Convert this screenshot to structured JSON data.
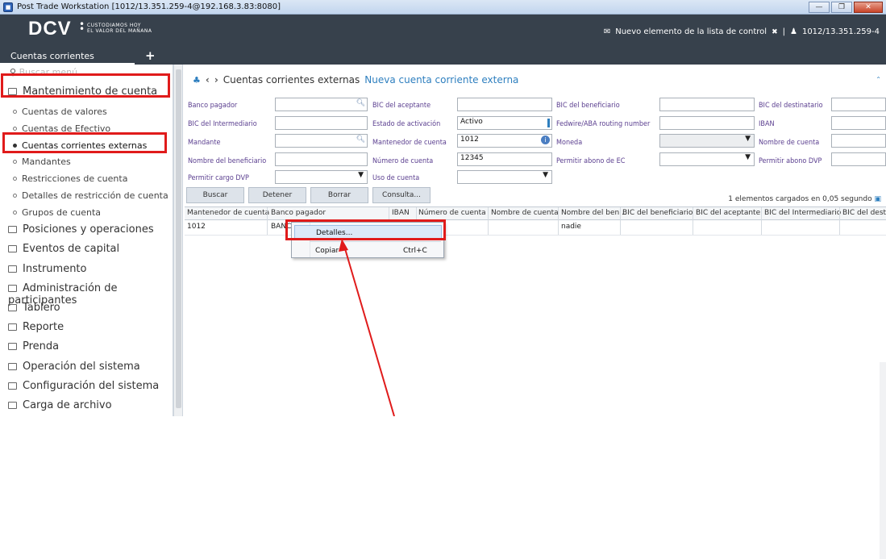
{
  "window": {
    "title": "Post Trade Workstation [1012/13.351.259-4@192.168.3.83:8080]",
    "controls": [
      "minimize-icon",
      "maximize-icon",
      "close-icon"
    ]
  },
  "header": {
    "logo": "DCV",
    "logo_tagline_1": "CUSTODIAMOS HOY",
    "logo_tagline_2": "EL VALOR DEL MAÑANA",
    "watchlist_label": "Nuevo elemento de la lista de control",
    "watchlist_close": "✖",
    "separator": "|",
    "user": "1012/13.351.259-4"
  },
  "tabs": {
    "active": "Cuentas corrientes externas",
    "add": "+"
  },
  "sidebar": {
    "search_placeholder": "Buscar menú",
    "section": "Mantenimiento de cuenta",
    "sub_items": [
      "Cuentas de valores",
      "Cuentas de Efectivo",
      "Cuentas corrientes externas",
      "Mandantes",
      "Restricciones de cuenta",
      "Detalles de restricción de cuenta",
      "Grupos de cuenta"
    ],
    "nav_items": [
      "Posiciones y operaciones",
      "Eventos de capital",
      "Instrumento",
      "Administración de participantes",
      "Tablero",
      "Reporte",
      "Prenda",
      "Operación del sistema",
      "Configuración del sistema",
      "Carga de archivo"
    ]
  },
  "breadcrumb": {
    "current": "Cuentas corrientes externas",
    "link": "Nueva cuenta corriente externa"
  },
  "form": {
    "banco_pagador": "Banco pagador",
    "bic_intermediario": "BIC del Intermediario",
    "mandante": "Mandante",
    "nombre_beneficiario": "Nombre del beneficiario",
    "permitir_cargo_dvp": "Permitir cargo DVP",
    "bic_aceptante": "BIC del aceptante",
    "estado_activacion": "Estado de activación",
    "estado_activacion_value": "Activo",
    "mantenedor_cuenta": "Mantenedor de cuenta",
    "mantenedor_cuenta_value": "1012",
    "numero_cuenta": "Número de cuenta",
    "numero_cuenta_value": "12345",
    "uso_cuenta": "Uso de cuenta",
    "bic_beneficiario": "BIC del beneficiario",
    "fedwire": "Fedwire/ABA routing number",
    "moneda": "Moneda",
    "permitir_abono_ec": "Permitir abono de EC",
    "bic_destinatario": "BIC del destinatario",
    "iban": "IBAN",
    "nombre_cuenta": "Nombre de cuenta",
    "permitir_abono_dvp": "Permitir abono DVP"
  },
  "actions": {
    "buscar": "Buscar",
    "detener": "Detener",
    "borrar": "Borrar",
    "consulta": "Consulta..."
  },
  "status": {
    "loaded": "1 elementos cargados en 0,05 segundo"
  },
  "table": {
    "columns": [
      "Mantenedor de cuenta",
      "Banco pagador",
      "IBAN",
      "Número de cuenta",
      "Nombre de cuenta",
      "Nombre del ben...",
      "BIC del beneficiario",
      "BIC del aceptante",
      "BIC del Intermediario",
      "BIC del destin"
    ],
    "rows": [
      {
        "mantenedor": "1012",
        "banco": "BANCO",
        "beneficiario": "nadie"
      }
    ]
  },
  "context_menu": {
    "items": [
      {
        "label": "Detalles...",
        "shortcut": ""
      },
      {
        "label": "Copiar",
        "shortcut": "Ctrl+C"
      }
    ]
  },
  "annotation_color": "#e01b1b"
}
